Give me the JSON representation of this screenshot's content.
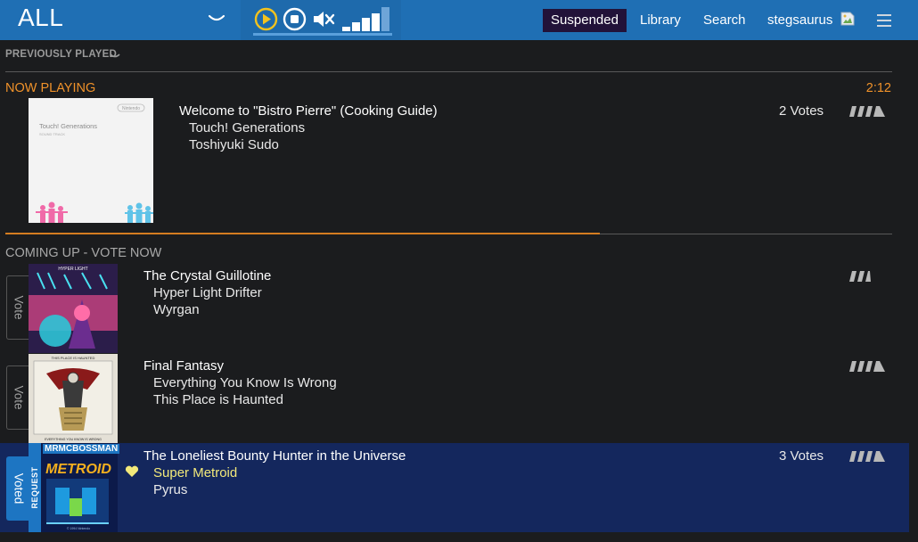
{
  "header": {
    "station": "ALL",
    "nav": {
      "suspended": "Suspended",
      "library": "Library",
      "search": "Search",
      "user": "stegsaurus"
    },
    "volume_level": 0.67
  },
  "previously_played": {
    "label": "PREVIOUSLY PLAYED"
  },
  "now_playing": {
    "heading": "NOW PLAYING",
    "time_remaining": "2:12",
    "title": "Welcome to \"Bistro Pierre\" (Cooking Guide)",
    "album": "Touch! Generations",
    "artist": "Toshiyuki Sudo",
    "votes": "2 Votes",
    "rating": 0.9,
    "progress": 0.67,
    "art": {
      "title": "Touch! Generations",
      "subtitle": "SOUND TRACK",
      "brand": "Nintendo"
    }
  },
  "queue": {
    "heading": "COMING UP - VOTE NOW",
    "items": [
      {
        "vote_label": "Vote",
        "title": "The Crystal Guillotine",
        "album": "Hyper Light Drifter",
        "artist": "Wyrgan",
        "votes": "",
        "rating": 0.5,
        "art": {
          "title": "HYPER LIGHT"
        }
      },
      {
        "vote_label": "Vote",
        "title": "Final Fantasy",
        "album": "Everything You Know Is Wrong",
        "artist": "This Place is Haunted",
        "votes": "",
        "rating": 0.9,
        "art": {
          "top": "THIS PLACE IS HAUNTED",
          "bottom": "EVERYTHING YOU KNOW IS WRONG"
        }
      },
      {
        "vote_label": "Voted",
        "title": "The Loneliest Bounty Hunter in the Universe",
        "album": "Super Metroid",
        "artist": "Pyrus",
        "votes": "3 Votes",
        "rating": 0.9,
        "request_label": "REQUEST",
        "requester": "MRMCBOSSMAN",
        "art": {
          "title": "METROID",
          "footer": "© 1994 Nintendo"
        }
      }
    ]
  },
  "colors": {
    "topbar": "#1f6fb4",
    "accent_orange": "#f0922a",
    "voted_row": "#14275d",
    "suspended_bg": "#221239",
    "gold": "#f3e97a"
  },
  "icons": {
    "play": "play-circle-icon",
    "stop": "stop-circle-icon",
    "mute": "speaker-mute-icon",
    "menu": "hamburger-menu-icon",
    "heart": "heart-icon",
    "rating": "rating-bars-icon"
  }
}
